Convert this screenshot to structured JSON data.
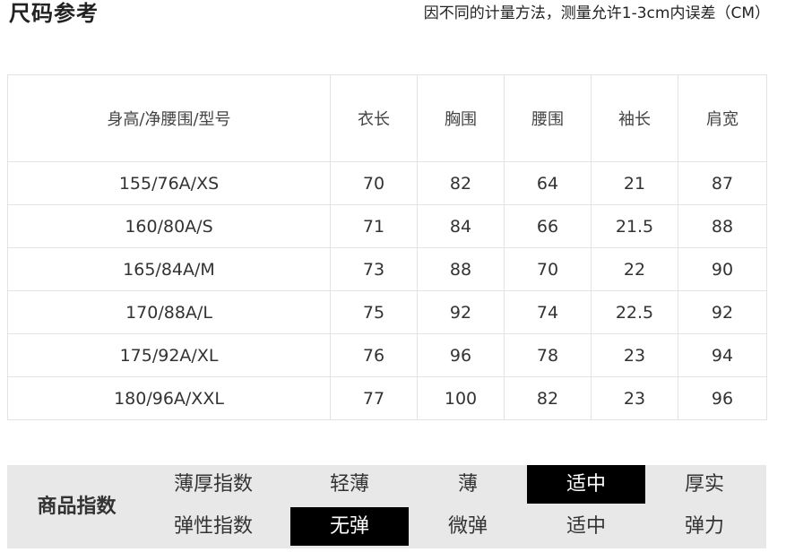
{
  "header": {
    "title": "尺码参考",
    "note": "因不同的计量方法，测量允许1-3cm内误差（CM）"
  },
  "size_table": {
    "headers": [
      "身高/净腰围/型号",
      "衣长",
      "胸围",
      "腰围",
      "袖长",
      "肩宽"
    ],
    "rows": [
      [
        "155/76A/XS",
        "70",
        "82",
        "64",
        "21",
        "87"
      ],
      [
        "160/80A/S",
        "71",
        "84",
        "66",
        "21.5",
        "88"
      ],
      [
        "165/84A/M",
        "73",
        "88",
        "70",
        "22",
        "90"
      ],
      [
        "170/88A/L",
        "75",
        "92",
        "74",
        "22.5",
        "92"
      ],
      [
        "175/92A/XL",
        "76",
        "96",
        "78",
        "23",
        "94"
      ],
      [
        "180/96A/XXL",
        "77",
        "100",
        "82",
        "23",
        "96"
      ]
    ]
  },
  "product_index": {
    "label": "商品指数",
    "thickness": {
      "name": "薄厚指数",
      "options": [
        "轻薄",
        "薄",
        "适中",
        "厚实"
      ],
      "selected": "适中"
    },
    "elasticity": {
      "name": "弹性指数",
      "options": [
        "无弹",
        "微弹",
        "适中",
        "弹力"
      ],
      "selected": "无弹"
    },
    "selected_bg_color": "#000000",
    "selected_text_color": "#ffffff",
    "panel_color": "#e8e8e8"
  }
}
